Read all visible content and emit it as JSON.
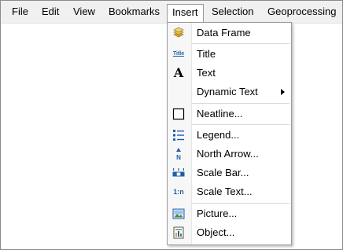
{
  "menubar": {
    "items": [
      {
        "label": "File"
      },
      {
        "label": "Edit"
      },
      {
        "label": "View"
      },
      {
        "label": "Bookmarks"
      },
      {
        "label": "Insert",
        "open": true
      },
      {
        "label": "Selection"
      },
      {
        "label": "Geoprocessing"
      }
    ]
  },
  "insert_menu": {
    "items": [
      {
        "label": "Data Frame",
        "icon": "data-frame-icon"
      },
      {
        "label": "Title",
        "icon": "title-icon",
        "icon_text": "Title"
      },
      {
        "label": "Text",
        "icon": "text-icon",
        "icon_text": "A"
      },
      {
        "label": "Dynamic Text",
        "icon": "none",
        "has_submenu": true
      },
      {
        "label": "Neatline...",
        "icon": "neatline-icon"
      },
      {
        "label": "Legend...",
        "icon": "legend-icon"
      },
      {
        "label": "North Arrow...",
        "icon": "north-arrow-icon",
        "icon_text": "N"
      },
      {
        "label": "Scale Bar...",
        "icon": "scale-bar-icon"
      },
      {
        "label": "Scale Text...",
        "icon": "scale-text-icon",
        "icon_text": "1:n"
      },
      {
        "label": "Picture...",
        "icon": "picture-icon"
      },
      {
        "label": "Object...",
        "icon": "object-icon"
      }
    ]
  },
  "colors": {
    "menubar_bg": "#f0f0f0",
    "icon_blue": "#1f5fa8",
    "icon_gold": "#d9a520"
  }
}
